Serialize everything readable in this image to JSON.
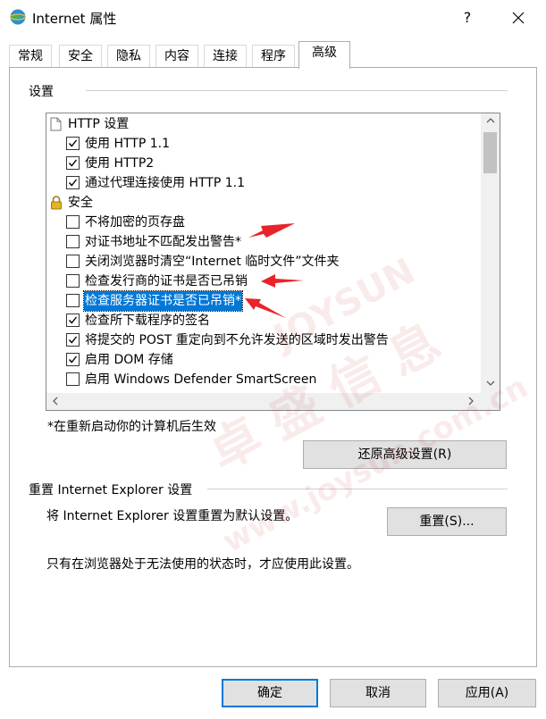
{
  "window": {
    "title": "Internet 属性",
    "help_label": "?",
    "close_label": "✕"
  },
  "tabs": [
    {
      "label": "常规"
    },
    {
      "label": "安全"
    },
    {
      "label": "隐私"
    },
    {
      "label": "内容"
    },
    {
      "label": "连接"
    },
    {
      "label": "程序"
    },
    {
      "label": "高级",
      "active": true
    }
  ],
  "settings": {
    "group_label": "设置",
    "rows": [
      {
        "kind": "header",
        "icon": "document-icon",
        "label": "HTTP 设置"
      },
      {
        "kind": "check",
        "checked": true,
        "label": "使用 HTTP 1.1"
      },
      {
        "kind": "check",
        "checked": true,
        "label": "使用 HTTP2"
      },
      {
        "kind": "check",
        "checked": true,
        "label": "通过代理连接使用 HTTP 1.1"
      },
      {
        "kind": "header",
        "icon": "lock-icon",
        "label": "安全"
      },
      {
        "kind": "check",
        "checked": false,
        "label": "不将加密的页存盘"
      },
      {
        "kind": "check",
        "checked": false,
        "label": "对证书地址不匹配发出警告*"
      },
      {
        "kind": "check",
        "checked": false,
        "label": "关闭浏览器时清空“Internet 临时文件”文件夹"
      },
      {
        "kind": "check",
        "checked": false,
        "label": "检查发行商的证书是否已吊销"
      },
      {
        "kind": "check",
        "checked": false,
        "selected": true,
        "label": "检查服务器证书是否已吊销*"
      },
      {
        "kind": "check",
        "checked": true,
        "label": "检查所下载程序的签名"
      },
      {
        "kind": "check",
        "checked": true,
        "label": "将提交的 POST 重定向到不允许发送的区域时发出警告"
      },
      {
        "kind": "check",
        "checked": true,
        "label": "启用 DOM 存储"
      },
      {
        "kind": "check",
        "checked": false,
        "label": "启用 Windows Defender SmartScreen"
      }
    ],
    "restart_note": "*在重新启动你的计算机后生效",
    "restore_button": "还原高级设置(R)"
  },
  "reset": {
    "group_label": "重置 Internet Explorer 设置",
    "description": "将 Internet Explorer 设置重置为默认设置。",
    "button": "重置(S)...",
    "warning": "只有在浏览器处于无法使用的状态时，才应使用此设置。"
  },
  "footer": {
    "ok": "确定",
    "cancel": "取消",
    "apply": "应用(A)"
  },
  "watermark": {
    "chinese": "卓 盛 信 息",
    "latin": "JOYSUN",
    "url": "www.joysun.com.cn"
  },
  "colors": {
    "accent": "#0078d7",
    "annotation_arrow": "#e8232a"
  }
}
